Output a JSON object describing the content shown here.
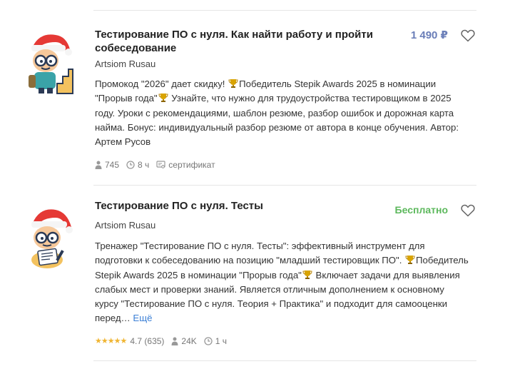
{
  "courses": [
    {
      "title": "Тестирование ПО с нуля. Как найти работу и пройти собеседование",
      "price": "1 490 ₽",
      "author": "Artsiom Rusau",
      "desc_parts": [
        "Промокод \"2026\" дает скидку! ",
        "Победитель Stepik Awards 2025 в номинации \"Прорыв года\"",
        " Узнайте, что нужно для трудоустройства тестировщиком в 2025 году. Уроки с рекомендациями, шаблон резюме, разбор ошибок и дорожная карта найма. Бонус: индивидуальный разбор резюме от автора в конце обучения. Автор: Артем Русов"
      ],
      "learners": "745",
      "duration": "8 ч",
      "certificate": "сертификат"
    },
    {
      "title": "Тестирование ПО с нуля. Тесты",
      "price": "Бесплатно",
      "author": "Artsiom Rusau",
      "desc_parts": [
        "Тренажер \"Тестирование ПО с нуля. Тесты\": эффективный инструмент для подготовки к собеседованию на позицию \"младший тестировщик ПО\". ",
        "Победитель Stepik Awards 2025 в номинации \"Прорыв года\"",
        " Включает задачи для выявления слабых мест и проверки знаний. Является отличным дополнением к основному курсу \"Тестирование ПО с нуля. Теория + Практика\" и подходит для самооценки перед…"
      ],
      "more": "Ещё",
      "rating": "4.7",
      "rating_count": "(635)",
      "learners": "24K",
      "duration": "1 ч"
    }
  ],
  "colors": {
    "price_paid": "#6a7eb8",
    "price_free": "#5cb85c",
    "link": "#3b7fd6",
    "star": "#f0b532"
  }
}
